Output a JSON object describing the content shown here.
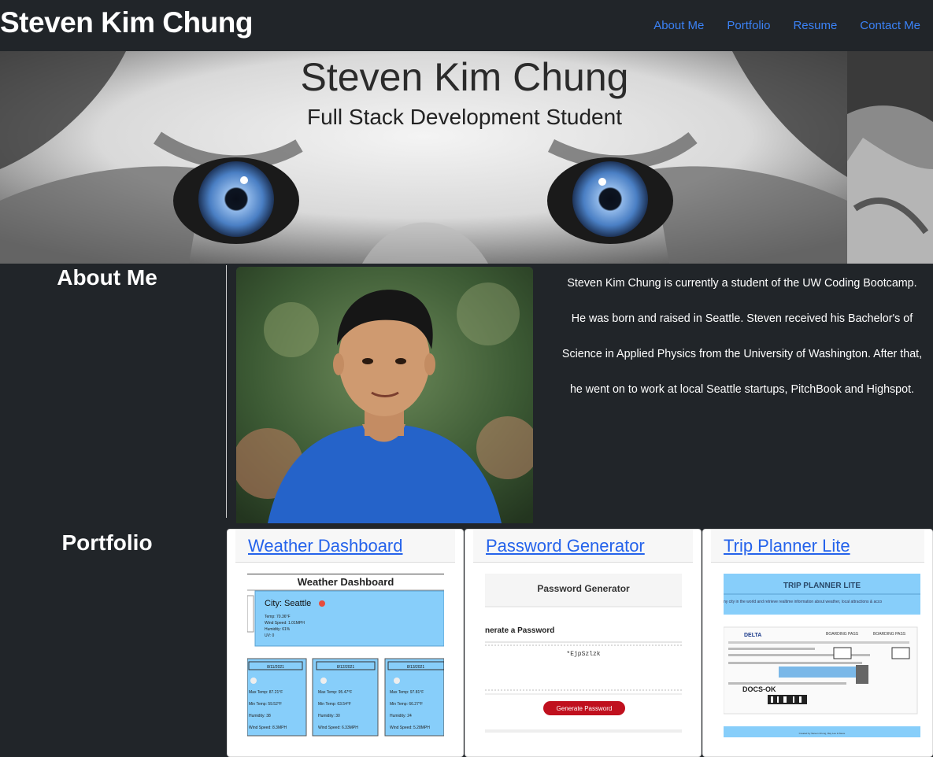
{
  "navbar": {
    "brand": "Steven Kim Chung",
    "links": [
      "About Me",
      "Portfolio",
      "Resume",
      "Contact Me"
    ]
  },
  "hero": {
    "title": "Steven Kim Chung",
    "subtitle": "Full Stack Development Student"
  },
  "about": {
    "heading": "About Me",
    "photo_icon": "portrait-photo",
    "bio_lines": [
      "Steven Kim Chung is currently a student of the UW Coding Bootcamp.",
      "He was born and raised in Seattle. Steven received his Bachelor's of",
      "Science in Applied Physics from the University of Washington. After that,",
      "he went on to work at local Seattle startups, PitchBook and Highspot."
    ]
  },
  "portfolio": {
    "heading": "Portfolio",
    "projects": [
      {
        "title": "Weather Dashboard",
        "screenshot": {
          "header": "Weather Dashboard",
          "city": "City: Seattle",
          "current": [
            "Temp: 70.36°F",
            "Wind Speed: 1.01MPH",
            "Humidity: 61%",
            "UV: 0"
          ],
          "forecast": [
            {
              "date": "8/11/2021",
              "lines": [
                "Max Temp: 87.21°F",
                "Min Temp: 59.52°F",
                "Humidity: 38",
                "Wind Speed: 8.3MPH"
              ]
            },
            {
              "date": "8/12/2021",
              "lines": [
                "Max Temp: 95.47°F",
                "Min Temp: 63.54°F",
                "Humidity: 30",
                "Wind Speed: 6.33MPH"
              ]
            },
            {
              "date": "8/13/2021",
              "lines": [
                "Max Temp: 97.81°F",
                "Min Temp: 66.27°F",
                "Humidity: 24",
                "Wind Speed: 5.28MPH"
              ]
            }
          ]
        }
      },
      {
        "title": "Password Generator",
        "screenshot": {
          "header": "Password Generator",
          "subheader": "nerate a Password",
          "password": "*EjpSzlzk",
          "button": "Generate Password"
        }
      },
      {
        "title": "Trip Planner Lite",
        "screenshot": {
          "header": "TRIP PLANNER LITE",
          "tagline": "ny city in the world and retrieve realtime information about weather, local attractions & acco",
          "pass_label": "BOARDING PASS",
          "airline": "DELTA",
          "docs": "DOCS-OK",
          "footer": "Created by Steven Chung, Ray Lee & Steve"
        }
      }
    ]
  },
  "colors": {
    "background": "#212529",
    "link": "#2563eb",
    "sky": "#87cefa",
    "danger": "#c0101e"
  }
}
